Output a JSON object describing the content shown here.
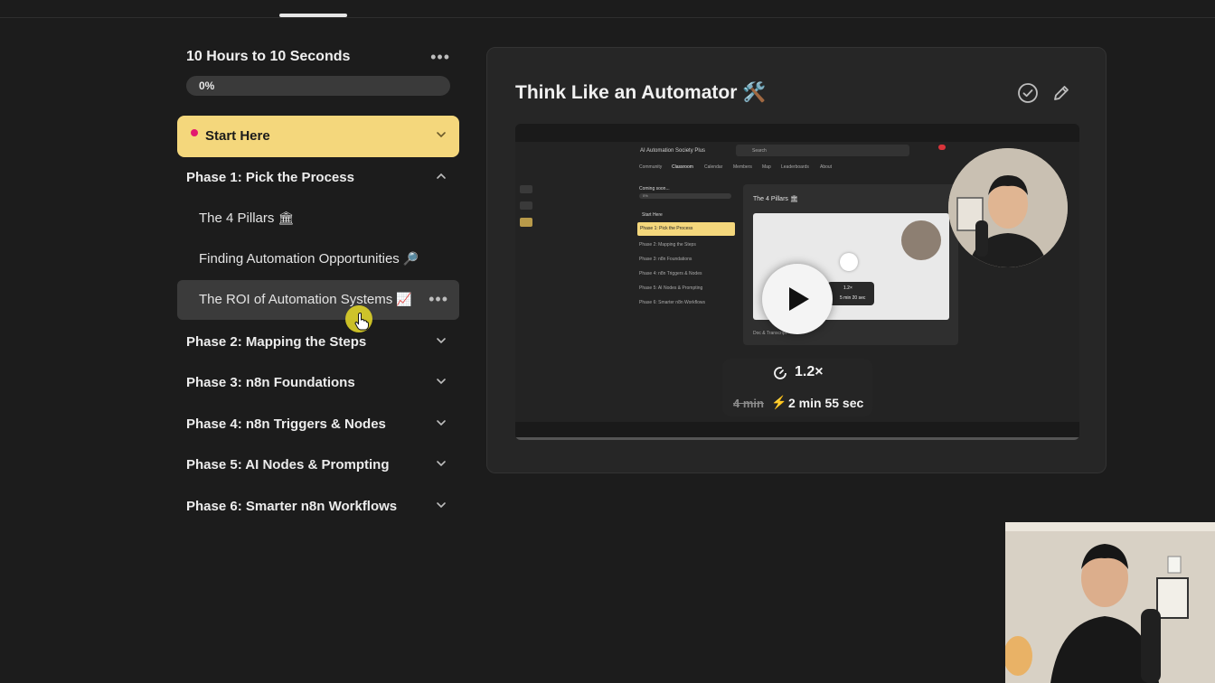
{
  "course": {
    "title": "10 Hours to 10 Seconds",
    "progress_label": "0%",
    "progress_fraction": 0
  },
  "modules": [
    {
      "label": "Start Here",
      "expanded": false,
      "highlighted": true
    },
    {
      "label": "Phase 1: Pick the Process",
      "expanded": true,
      "lessons": [
        {
          "label": "The 4 Pillars",
          "emoji": "🏛"
        },
        {
          "label": "Finding Automation Opportunities",
          "emoji": "🔎"
        },
        {
          "label": "The ROI of Automation Systems",
          "emoji": "📈",
          "active": true
        }
      ]
    },
    {
      "label": "Phase 2: Mapping the Steps",
      "expanded": false
    },
    {
      "label": "Phase 3: n8n Foundations",
      "expanded": false
    },
    {
      "label": "Phase 4: n8n Triggers & Nodes",
      "expanded": false
    },
    {
      "label": "Phase 5: AI Nodes & Prompting",
      "expanded": false
    },
    {
      "label": "Phase 6: Smarter n8n Workflows",
      "expanded": false
    }
  ],
  "lesson": {
    "title": "Think Like an Automator 🛠️",
    "icons": {
      "complete": "check-circle-icon",
      "edit": "pencil-icon"
    }
  },
  "video": {
    "speed": "1.2×",
    "original_duration": "4 min",
    "new_duration": "2 min 55 sec",
    "screenshot": {
      "app_name": "AI Automation Society Plus",
      "search": "Search",
      "nav": [
        "Community",
        "Classroom",
        "Calendar",
        "Members",
        "Map",
        "Leaderboards",
        "About"
      ],
      "course_title": "Coming soon...",
      "progress": "0%",
      "sidebar": [
        "Start Here",
        "Phase 1: Pick the Process",
        "Phase 2: Mapping the Steps",
        "Phase 3: n8n Foundations",
        "Phase 4: n8n Triggers & Nodes",
        "Phase 5: AI Nodes & Prompting",
        "Phase 6: Smarter n8n Workflows"
      ],
      "lesson_title": "The 4 Pillars 🏛",
      "speed": "1.2×",
      "duration": "5 min 20 sec",
      "footer": "Doc & Transcript"
    }
  },
  "colors": {
    "background": "#1c1c1c",
    "panel": "#262626",
    "start_module": "#f4d77c",
    "accent_dot": "#e2186f",
    "bolt": "#f28c28",
    "cursor_highlight": "#e2d628"
  }
}
